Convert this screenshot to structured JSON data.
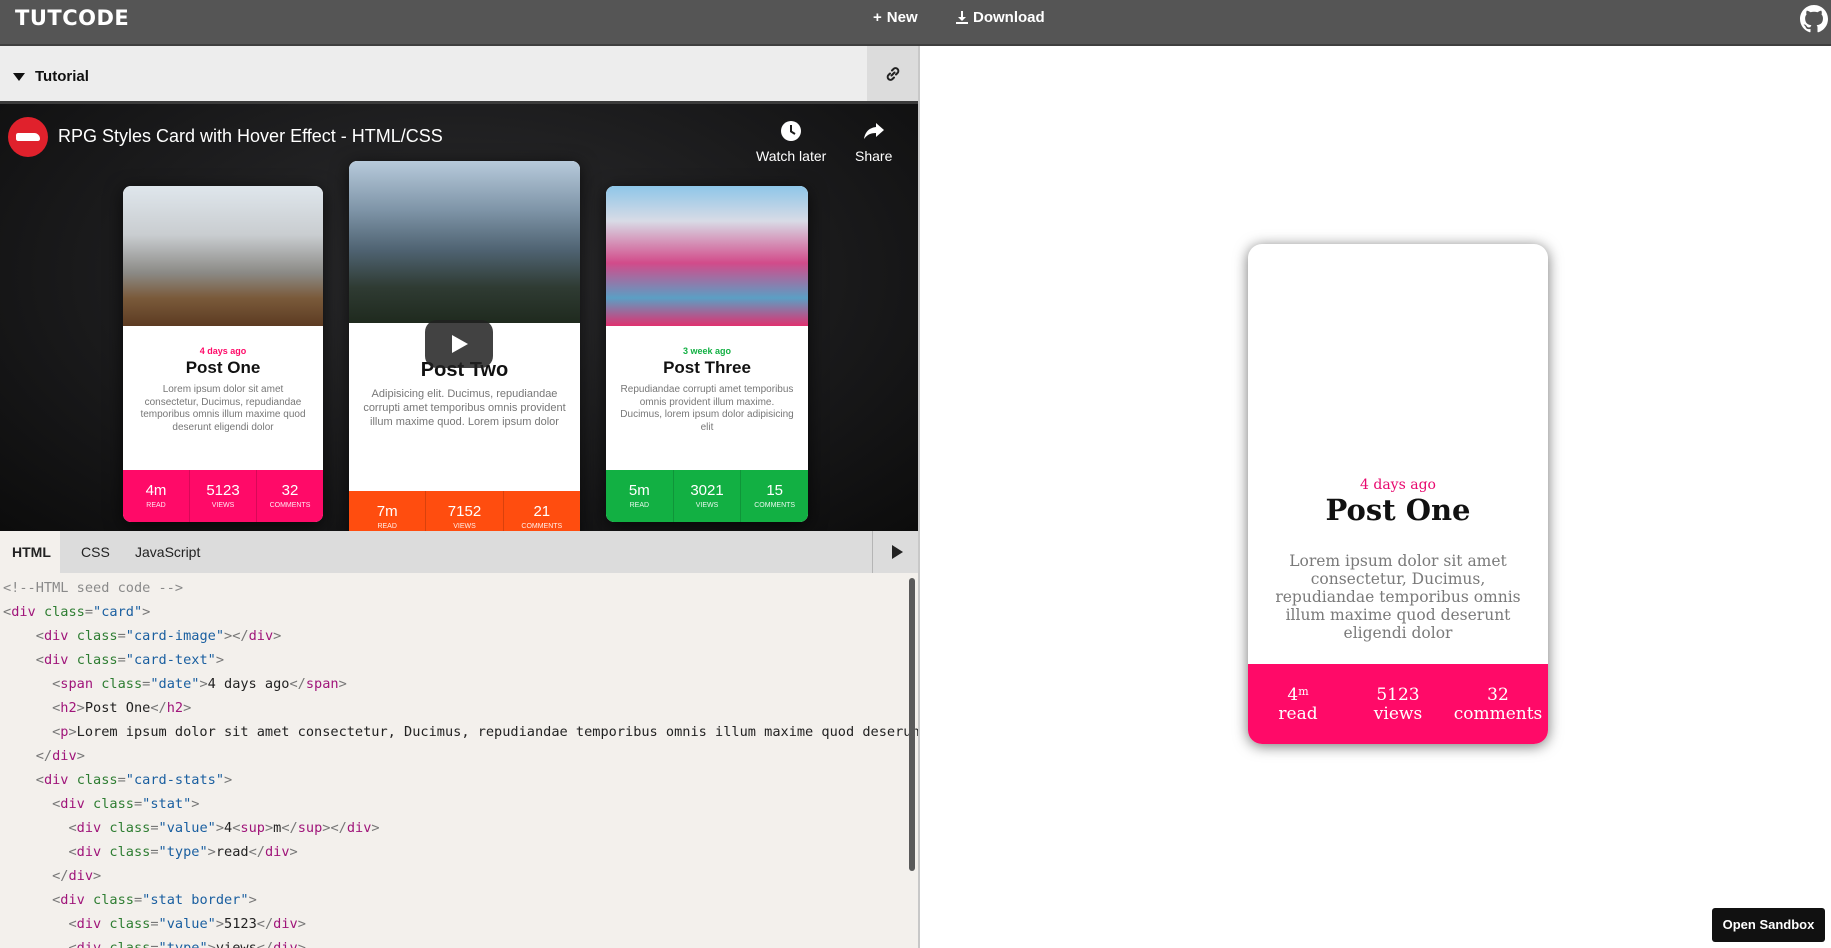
{
  "header": {
    "brand": "TUTCODE",
    "new_label": "New",
    "download_label": "Download"
  },
  "tutorial": {
    "toggle_label": "Tutorial"
  },
  "video": {
    "title": "RPG Styles Card with Hover Effect - HTML/CSS",
    "watch_later": "Watch later",
    "share": "Share",
    "cards": [
      {
        "date": "4 days ago",
        "title": "Post One",
        "text": "Lorem ipsum dolor sit amet consectetur, Ducimus, repudiandae temporibus omnis illum maxime quod deserunt eligendi dolor",
        "accent": "#ff0a68",
        "stats": [
          {
            "value": "4m",
            "type": "Read"
          },
          {
            "value": "5123",
            "type": "Views"
          },
          {
            "value": "32",
            "type": "Comments"
          }
        ]
      },
      {
        "date": "",
        "title": "Post Two",
        "text": "Adipisicing elit. Ducimus, repudiandae corrupti amet temporibus omnis provident illum maxime quod. Lorem ipsum dolor",
        "accent": "#ff4d0f",
        "stats": [
          {
            "value": "7m",
            "type": "Read"
          },
          {
            "value": "7152",
            "type": "Views"
          },
          {
            "value": "21",
            "type": "Comments"
          }
        ]
      },
      {
        "date": "3 week ago",
        "title": "Post Three",
        "text": "Repudiandae corrupti amet temporibus omnis provident illum maxime. Ducimus, lorem ipsum dolor adipisicing elit",
        "accent": "#12b043",
        "stats": [
          {
            "value": "5m",
            "type": "Read"
          },
          {
            "value": "3021",
            "type": "Views"
          },
          {
            "value": "15",
            "type": "Comments"
          }
        ]
      }
    ]
  },
  "editor": {
    "tabs": [
      "HTML",
      "CSS",
      "JavaScript"
    ],
    "active_tab": "HTML"
  },
  "preview": {
    "date": "4 days ago",
    "title": "Post One",
    "text": "Lorem ipsum dolor sit amet consectetur, Ducimus, repudiandae temporibus omnis illum maxime quod deserunt eligendi dolor",
    "stats": [
      {
        "value": "4",
        "sup": "m",
        "type": "read"
      },
      {
        "value": "5123",
        "sup": "",
        "type": "views"
      },
      {
        "value": "32",
        "sup": "",
        "type": "comments"
      }
    ],
    "accent": "#ff0a68",
    "date_color": "#e8096f",
    "open_sandbox": "Open Sandbox"
  }
}
